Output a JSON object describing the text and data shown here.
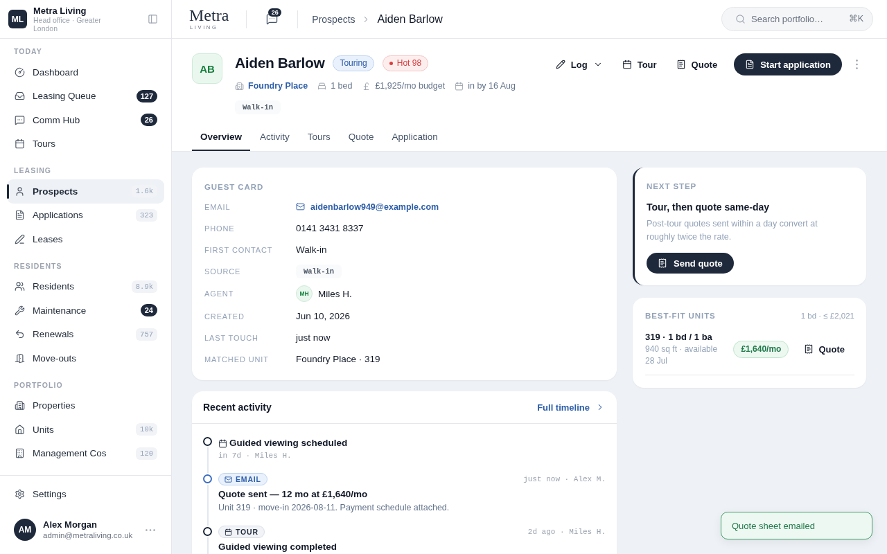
{
  "sidebar": {
    "org": {
      "initials": "ML",
      "name": "Metra Living",
      "subtitle": "Head office · Greater London"
    },
    "sections": [
      {
        "title": "TODAY",
        "items": [
          {
            "label": "Dashboard",
            "selected": false
          },
          {
            "label": "Leasing Queue",
            "selected": false,
            "badge": {
              "text": "127",
              "kind": "alert"
            }
          },
          {
            "label": "Comm Hub",
            "selected": false,
            "badge": {
              "text": "26",
              "kind": "alert"
            }
          },
          {
            "label": "Tours",
            "selected": false
          }
        ]
      },
      {
        "title": "LEASING",
        "items": [
          {
            "label": "Prospects",
            "selected": true,
            "badge": {
              "text": "1.6k",
              "kind": "count"
            }
          },
          {
            "label": "Applications",
            "selected": false,
            "badge": {
              "text": "323",
              "kind": "count"
            }
          },
          {
            "label": "Leases",
            "selected": false
          }
        ]
      },
      {
        "title": "RESIDENTS",
        "items": [
          {
            "label": "Residents",
            "selected": false,
            "badge": {
              "text": "8.9k",
              "kind": "count"
            }
          },
          {
            "label": "Maintenance",
            "selected": false,
            "badge": {
              "text": "24",
              "kind": "alert"
            }
          },
          {
            "label": "Renewals",
            "selected": false,
            "badge": {
              "text": "757",
              "kind": "count"
            }
          },
          {
            "label": "Move-outs",
            "selected": false
          }
        ]
      },
      {
        "title": "PORTFOLIO",
        "items": [
          {
            "label": "Properties",
            "selected": false
          },
          {
            "label": "Units",
            "selected": false,
            "badge": {
              "text": "10k",
              "kind": "count"
            }
          },
          {
            "label": "Management Cos",
            "selected": false,
            "badge": {
              "text": "120",
              "kind": "count"
            }
          }
        ]
      }
    ],
    "settings": "Settings",
    "user": {
      "initials": "AM",
      "name": "Alex Morgan",
      "email": "admin@metraliving.co.uk"
    }
  },
  "topbar": {
    "logo": {
      "name": "Metra",
      "tagline": "LIVING"
    },
    "messages_badge": "26",
    "breadcrumb": [
      "Prospects",
      "Aiden Barlow"
    ],
    "search": {
      "placeholder": "Search portfolio…",
      "shortcut": "⌘K"
    }
  },
  "prospect": {
    "initials": "AB",
    "name": "Aiden Barlow",
    "chips": [
      {
        "label": "Touring",
        "kind": "stage"
      },
      {
        "label": "Hot 98",
        "kind": "score"
      }
    ],
    "meta": [
      {
        "text": "Foundry Place",
        "kind": "property"
      },
      {
        "text": "1 bed",
        "kind": "beds"
      },
      {
        "text": "£1,925/mo budget",
        "kind": "budget"
      },
      {
        "text": "in by 16 Aug",
        "kind": "move_in"
      }
    ],
    "source_tag": "Walk-in",
    "actions": [
      {
        "label": "Log",
        "kind": "log"
      },
      {
        "label": "Tour",
        "kind": "tour"
      },
      {
        "label": "Quote",
        "kind": "quote"
      },
      {
        "label": "Start application",
        "kind": "primary"
      }
    ]
  },
  "tabs": [
    {
      "label": "Overview",
      "selected": true
    },
    {
      "label": "Activity",
      "selected": false
    },
    {
      "label": "Tours",
      "selected": false
    },
    {
      "label": "Quote",
      "selected": false
    },
    {
      "label": "Application",
      "selected": false
    }
  ],
  "guest_card": {
    "title": "GUEST CARD",
    "fields": [
      {
        "label": "EMAIL",
        "value": "aidenbarlow949@example.com",
        "kind": "email"
      },
      {
        "label": "PHONE",
        "value": "0141 3431 8337",
        "kind": "text"
      },
      {
        "label": "FIRST CONTACT",
        "value": "Walk-in",
        "kind": "text"
      },
      {
        "label": "SOURCE",
        "value": "Walk-in",
        "kind": "tag"
      },
      {
        "label": "AGENT",
        "value": "Miles H.",
        "initials": "MH",
        "kind": "person"
      },
      {
        "label": "CREATED",
        "value": "Jun 10, 2026",
        "kind": "text"
      },
      {
        "label": "LAST TOUCH",
        "value": "just now",
        "kind": "text"
      },
      {
        "label": "MATCHED UNIT",
        "value": "Foundry Place · 319",
        "kind": "text"
      }
    ]
  },
  "activity": {
    "title": "Recent activity",
    "link": "Full timeline",
    "items": [
      {
        "kind": "scheduled",
        "title": "Guided viewing scheduled",
        "meta": "in 7d · Miles H."
      },
      {
        "kind": "email",
        "tag": "EMAIL",
        "meta": "just now · Alex M.",
        "title": "Quote sent — 12 mo at £1,640/mo",
        "description": "Unit 319 · move-in 2026-08-11. Payment schedule attached."
      },
      {
        "kind": "tour",
        "tag": "TOUR",
        "meta": "2d ago · Miles H.",
        "title": "Guided viewing completed"
      }
    ]
  },
  "next_step": {
    "eyebrow": "NEXT STEP",
    "title": "Tour, then quote same-day",
    "body": "Post-tour quotes sent within a day convert at roughly twice the rate.",
    "button": "Send quote"
  },
  "best_fit": {
    "title": "BEST-FIT UNITS",
    "filter": "1 bd · ≤ £2,021",
    "units": [
      {
        "name": "319 · 1 bd / 1 ba",
        "details": "940 sq ft · available 28 Jul",
        "price": "£1,640/mo",
        "action": "Quote"
      }
    ]
  },
  "toast": {
    "message": "Quote sheet emailed"
  }
}
